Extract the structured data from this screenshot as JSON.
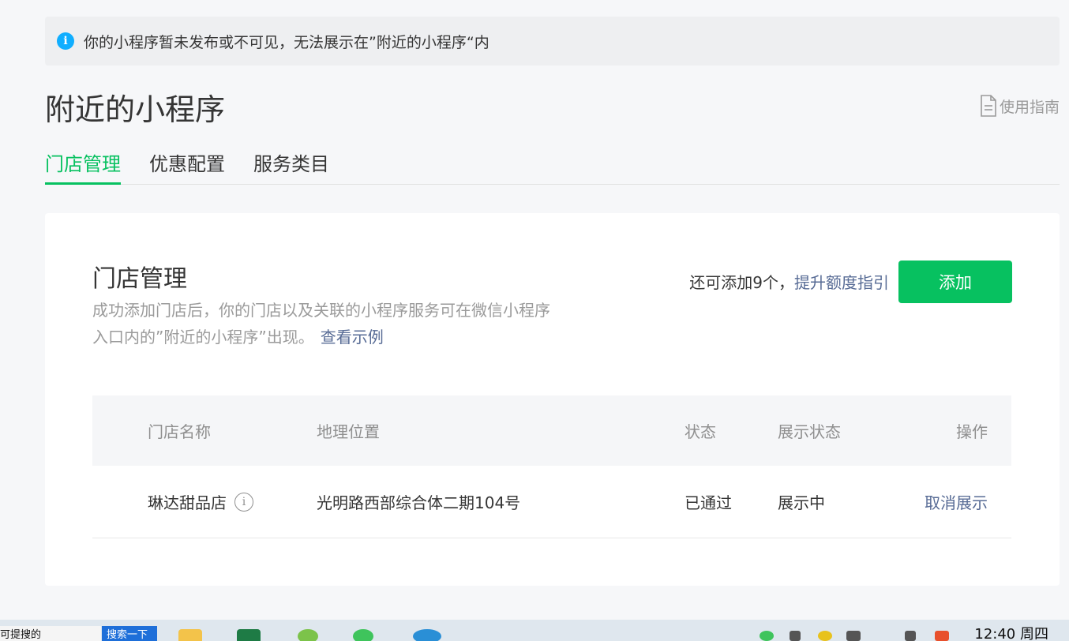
{
  "notice": {
    "text": "你的小程序暂未发布或不可见，无法展示在”附近的小程序“内",
    "icon": "info-icon"
  },
  "page": {
    "title": "附近的小程序",
    "guide_label": "使用指南"
  },
  "tabs": [
    {
      "label": "门店管理",
      "active": true
    },
    {
      "label": "优惠配置",
      "active": false
    },
    {
      "label": "服务类目",
      "active": false
    }
  ],
  "card": {
    "title": "门店管理",
    "description": "成功添加门店后，你的门店以及关联的小程序服务可在微信小程序入口内的”附近的小程序”出现。",
    "example_link": "查看示例",
    "quota_text": "还可添加9个，",
    "quota_link": "提升额度指引",
    "add_button": "添加"
  },
  "table": {
    "headers": [
      "门店名称",
      "地理位置",
      "状态",
      "展示状态",
      "操作"
    ],
    "rows": [
      {
        "name": "琳达甜品店",
        "location": "光明路西部综合体二期104号",
        "status": "已通过",
        "display_status": "展示中",
        "action": "取消展示"
      }
    ]
  },
  "taskbar": {
    "search_text": "可提搜的",
    "search_button": "搜索一下",
    "clock": "12:40 周四"
  },
  "colors": {
    "accent": "#07c160",
    "link": "#576b95",
    "info": "#10aeff"
  }
}
